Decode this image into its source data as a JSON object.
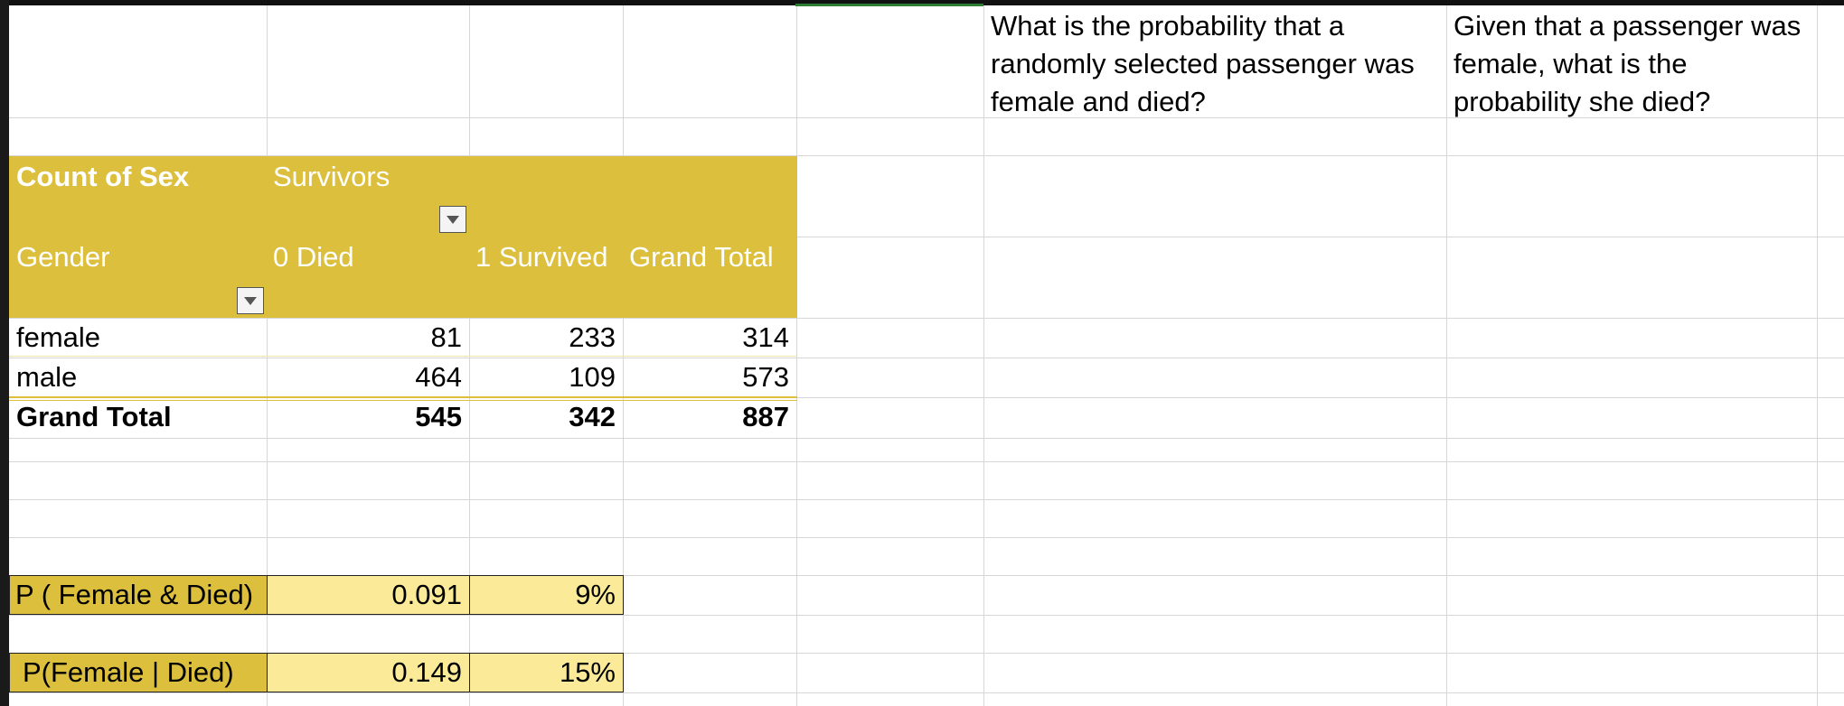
{
  "pivot": {
    "title": "Count of Sex",
    "column_field": "Survivors",
    "row_field": "Gender",
    "columns": [
      "0 Died",
      "1 Survived",
      "Grand Total"
    ],
    "rows": [
      {
        "label": "female",
        "died": "81",
        "survived": "233",
        "total": "314"
      },
      {
        "label": "male",
        "died": "464",
        "survived": "109",
        "total": "573"
      }
    ],
    "grand_total": {
      "label": "Grand Total",
      "died": "545",
      "survived": "342",
      "total": "887"
    }
  },
  "results": [
    {
      "label": "P ( Female & Died)",
      "decimal": "0.091",
      "percent": "9%"
    },
    {
      "label": "P(Female | Died)",
      "decimal": "0.149",
      "percent": "15%"
    }
  ],
  "questions": [
    "What is the probability that a randomly selected passenger was female and died?",
    "Given that a passenger was female, what is the probability she died?"
  ],
  "colors": {
    "header": "#dcbf3d",
    "value_fill": "#fbeb99"
  }
}
